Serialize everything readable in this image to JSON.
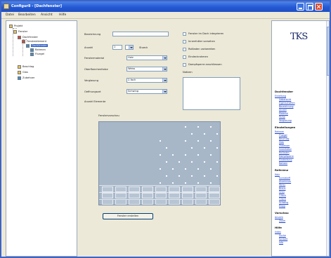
{
  "window": {
    "title": "Configur8 - [Dachfenster]"
  },
  "menu": [
    "Datei",
    "Bearbeiten",
    "Ansicht",
    "Hilfe"
  ],
  "tree": {
    "items": [
      {
        "label": "Projekt",
        "icon": "folder-icon",
        "color": "#e8c35a"
      },
      {
        "label": "Fenster",
        "icon": "folder-icon",
        "color": "#e8c35a"
      },
      {
        "label": "Dachfenster",
        "icon": "window-icon",
        "color": "#cc4a3c"
      },
      {
        "label": "Fensterelement",
        "icon": "window-icon",
        "color": "#cc4a3c"
      },
      {
        "label": "Dachfenster",
        "icon": "window-icon",
        "color": "#3a8fd6",
        "selected": true
      },
      {
        "label": "Rahmen",
        "icon": "part-icon",
        "color": "#3a8fd6"
      },
      {
        "label": "Fluegel",
        "icon": "part-icon",
        "color": "#3a8fd6"
      },
      {
        "label": "Beschlag",
        "icon": "part-icon",
        "color": "#e8c35a"
      },
      {
        "label": "Glas",
        "icon": "part-icon",
        "color": "#e8c35a"
      },
      {
        "label": "Zubehoer",
        "icon": "part-icon",
        "color": "#3a8fd6"
      }
    ]
  },
  "form": {
    "bezeichnung": {
      "label": "Bezeichnung",
      "value": ""
    },
    "anzahl": {
      "label": "Anzahl",
      "value": "1",
      "unit": "Stueck"
    },
    "fields": [
      {
        "label": "Fenstermaterial",
        "value": "Holz"
      },
      {
        "label": "Oberflaechenfarbe",
        "value": "Weiss"
      },
      {
        "label": "Verglasung",
        "value": "2-fach"
      },
      {
        "label": "Oeffnungsart",
        "value": "Schwing"
      }
    ],
    "extra_label": "Anzahl Elemente",
    "checks": [
      "Fenster im Dach integrieren",
      "Innenfutter vorsehen",
      "Rollladen vorbereiten",
      "Eindeckrahmen",
      "Dampfsperre anschliessen"
    ],
    "notes_label": "Notizen",
    "preview_label": "Fenstervorschau",
    "build_button": "Fenster erstellen"
  },
  "help": {
    "logo": "TKS",
    "sections": [
      {
        "title": "Dachfenster",
        "links": [
          "Einleitung",
          "Uebersicht",
          "Eigenschaften",
          "Bezeichnung",
          "Anzahl",
          "Material",
          "Farbe",
          "Verglasung"
        ]
      },
      {
        "title": "Einstellungen",
        "links": [
          "Rahmen",
          "Fluegel",
          "Beschlag",
          "Glas",
          "Zubehoer",
          "Innenfutter",
          "Rollladen",
          "Dampfsperre",
          "Eindeckung",
          "Notizen"
        ]
      },
      {
        "title": "Referenz",
        "links": [
          "Holz",
          "Kunststoff",
          "Aluminium",
          "Weiss",
          "Braun",
          "Grau",
          "2-fach",
          "3-fach",
          "Schwing",
          "Klapp"
        ]
      },
      {
        "title": "Vorschau",
        "links": [
          "Ansicht",
          "Zoom"
        ]
      },
      {
        "title": "Hilfe",
        "links": [
          "Index",
          "Suche",
          "Kontakt",
          "Info"
        ]
      }
    ]
  }
}
